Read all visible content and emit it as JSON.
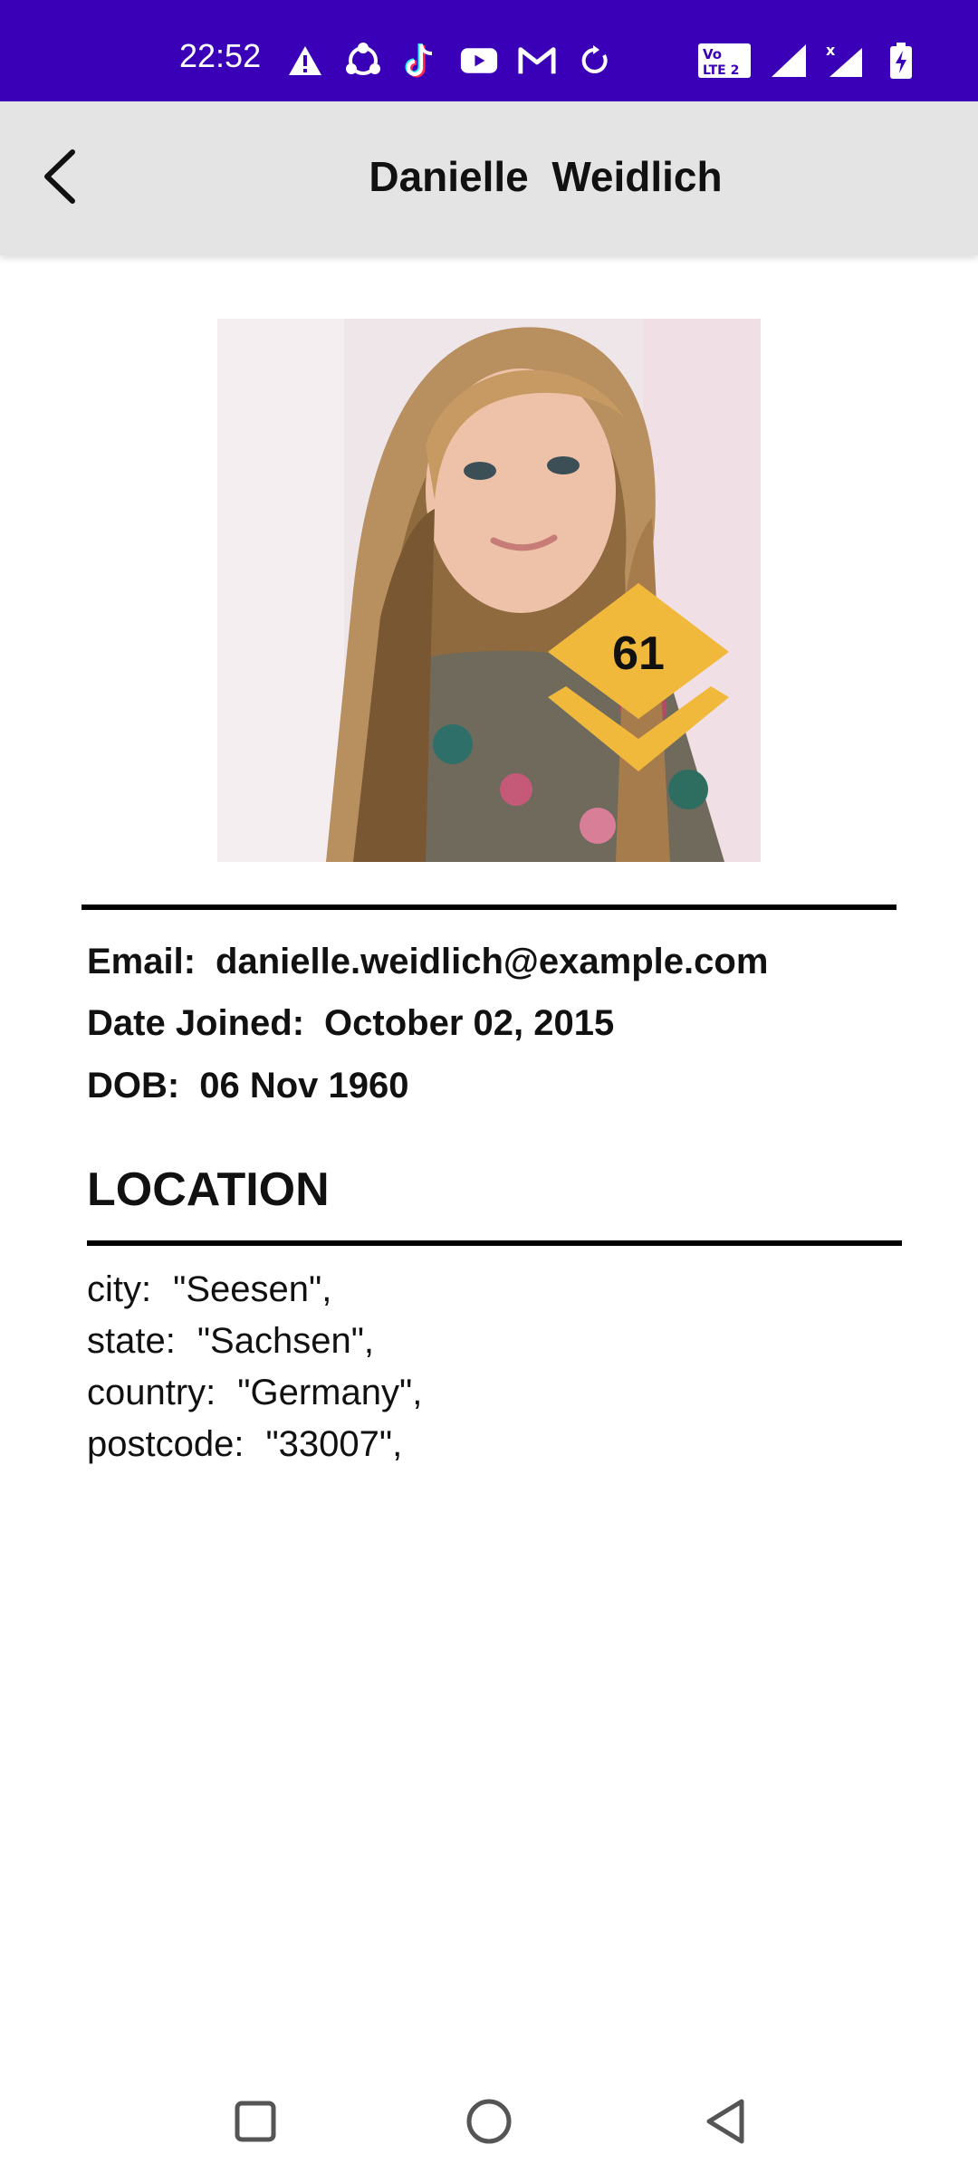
{
  "status_bar": {
    "time": "22:52",
    "icons_left": [
      "warning-icon",
      "share-icon",
      "tiktok-icon",
      "youtube-icon",
      "gmail-icon",
      "sync-icon"
    ],
    "icons_right": [
      "volte-icon",
      "signal-icon",
      "signal-x-icon",
      "battery-charging-icon"
    ]
  },
  "header": {
    "title": "Danielle  Weidlich",
    "back_icon": "arrow-back-icon"
  },
  "profile": {
    "level": "61",
    "badge_color": "#f0b93c",
    "email_label": "Email:",
    "email": "danielle.weidlich@example.com",
    "joined_label": "Date Joined:",
    "joined": "October 02, 2015",
    "dob_label": "DOB:",
    "dob": "06 Nov 1960"
  },
  "location": {
    "title": "LOCATION",
    "items": [
      {
        "label": "city:",
        "value": "\"Seesen\","
      },
      {
        "label": "state:",
        "value": "\"Sachsen\","
      },
      {
        "label": "country:",
        "value": "\"Germany\","
      },
      {
        "label": "postcode:",
        "value": "\"33007\","
      }
    ]
  },
  "nav": {
    "icons": [
      "recents-square-icon",
      "home-circle-icon",
      "back-triangle-icon"
    ]
  }
}
